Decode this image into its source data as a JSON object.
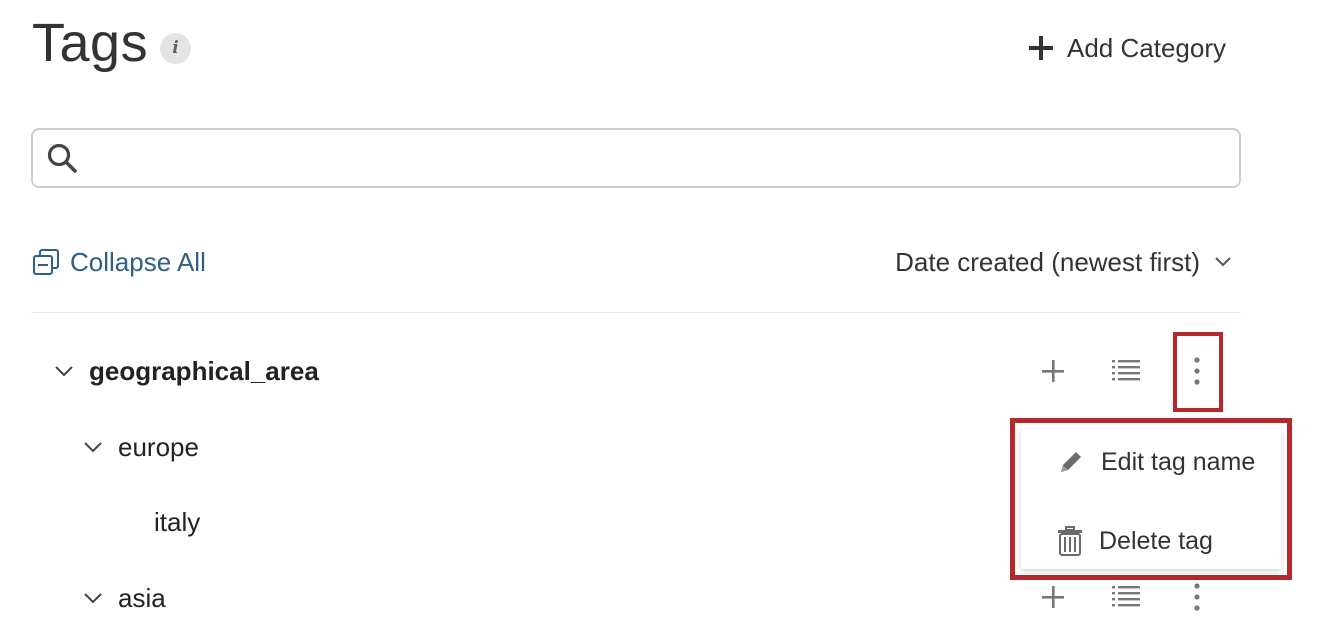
{
  "header": {
    "title": "Tags",
    "info_glyph": "i",
    "add_category_label": "Add Category"
  },
  "search": {
    "placeholder": "",
    "value": ""
  },
  "toolbar": {
    "collapse_all_label": "Collapse All",
    "sort_label": "Date created (newest first)"
  },
  "tree": [
    {
      "label": "geographical_area",
      "level": 0,
      "expanded": true,
      "bold": true
    },
    {
      "label": "europe",
      "level": 1,
      "expanded": true,
      "bold": false
    },
    {
      "label": "italy",
      "level": 2,
      "expanded": false,
      "bold": false
    },
    {
      "label": "asia",
      "level": 1,
      "expanded": true,
      "bold": false
    }
  ],
  "context_menu": {
    "items": [
      {
        "label": "Edit tag name",
        "icon": "pencil-icon"
      },
      {
        "label": "Delete tag",
        "icon": "trash-icon"
      }
    ]
  },
  "colors": {
    "accent_link": "#2f5f86",
    "highlight_red": "#b3292e",
    "icon_gray": "#777777"
  }
}
